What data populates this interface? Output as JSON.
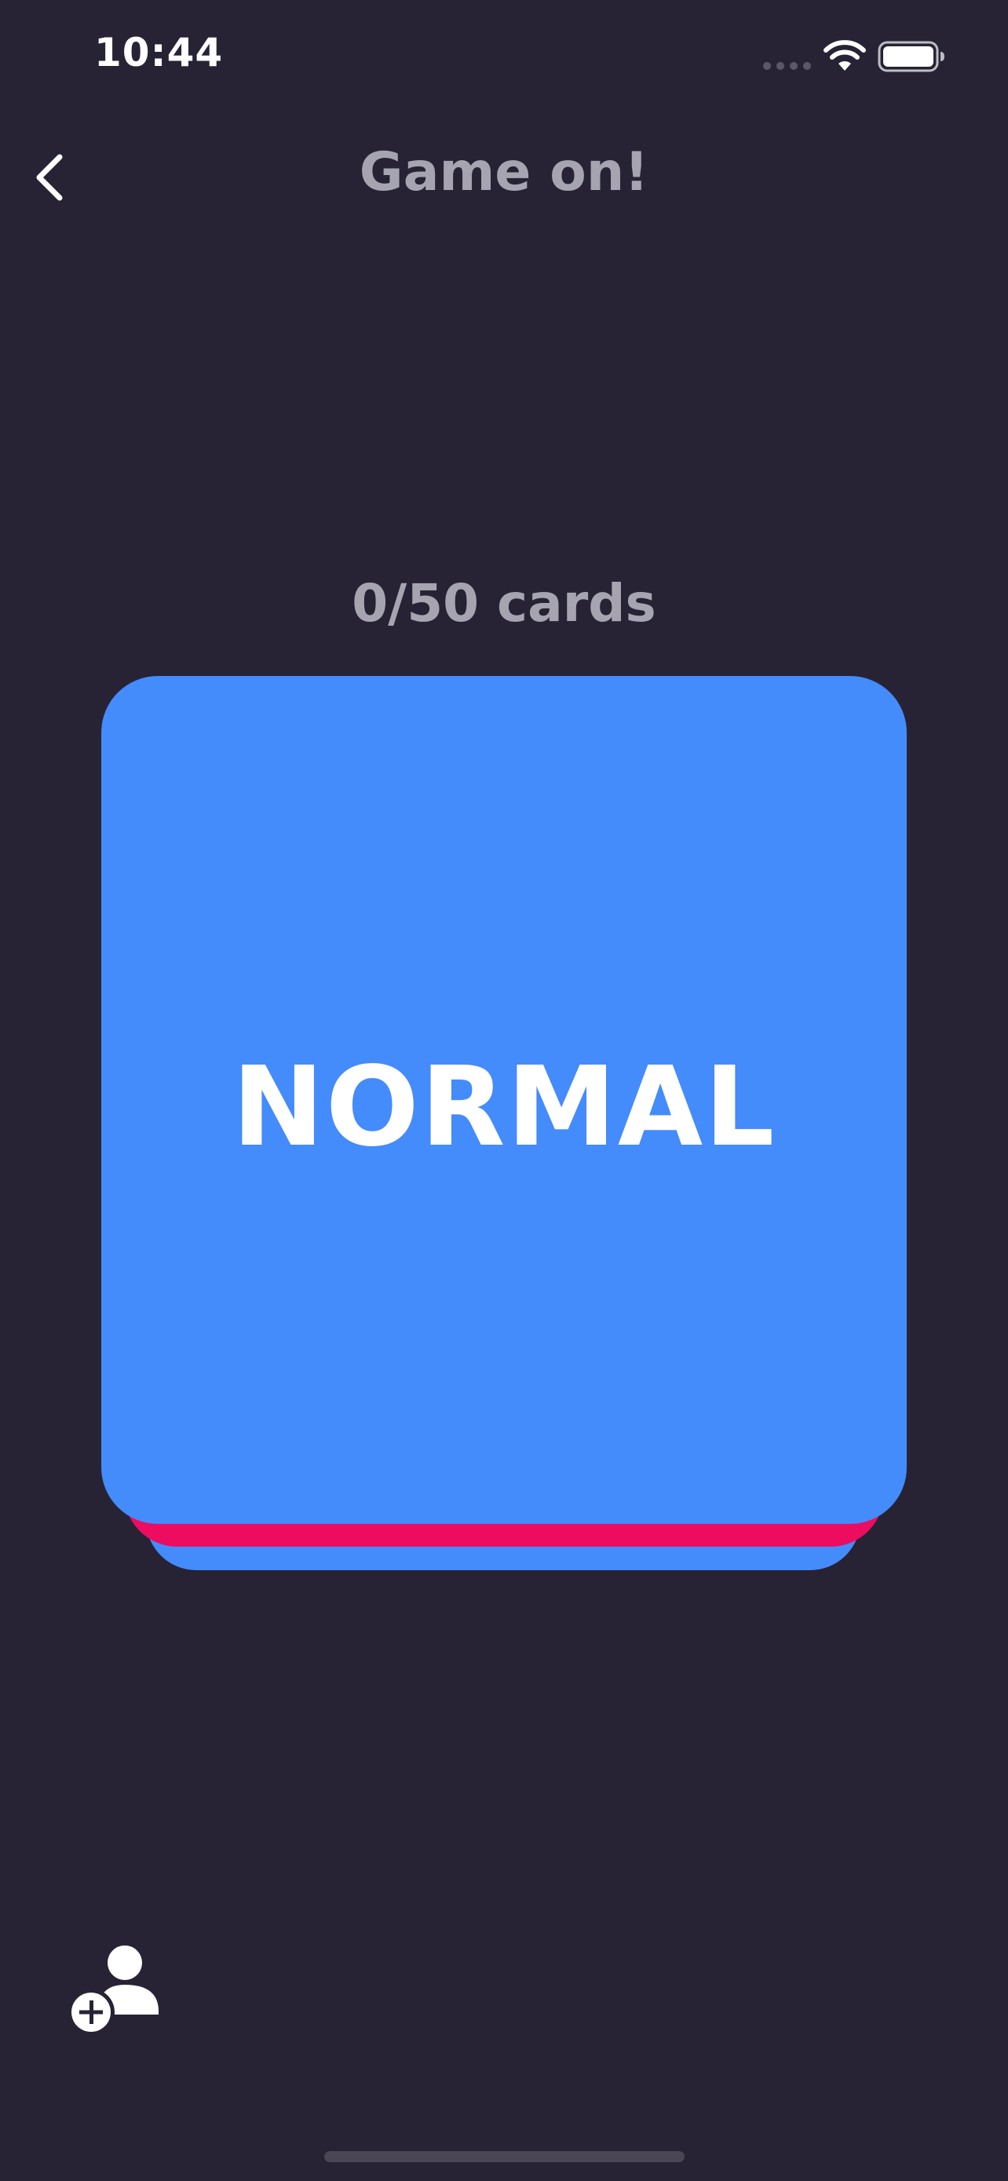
{
  "status_bar": {
    "time": "10:44"
  },
  "header": {
    "title": "Game on!",
    "back_icon": "chevron-left-icon"
  },
  "counter": {
    "text": "0/50 cards"
  },
  "card": {
    "label": "NORMAL",
    "color": "#448bfc",
    "stack_colors": [
      "#ec0d61",
      "#448bfc"
    ]
  },
  "actions": {
    "add_player_icon": "add-person-icon"
  },
  "colors": {
    "background": "#272335",
    "title_text": "#a7a4b1",
    "card_text": "#ffffff"
  }
}
